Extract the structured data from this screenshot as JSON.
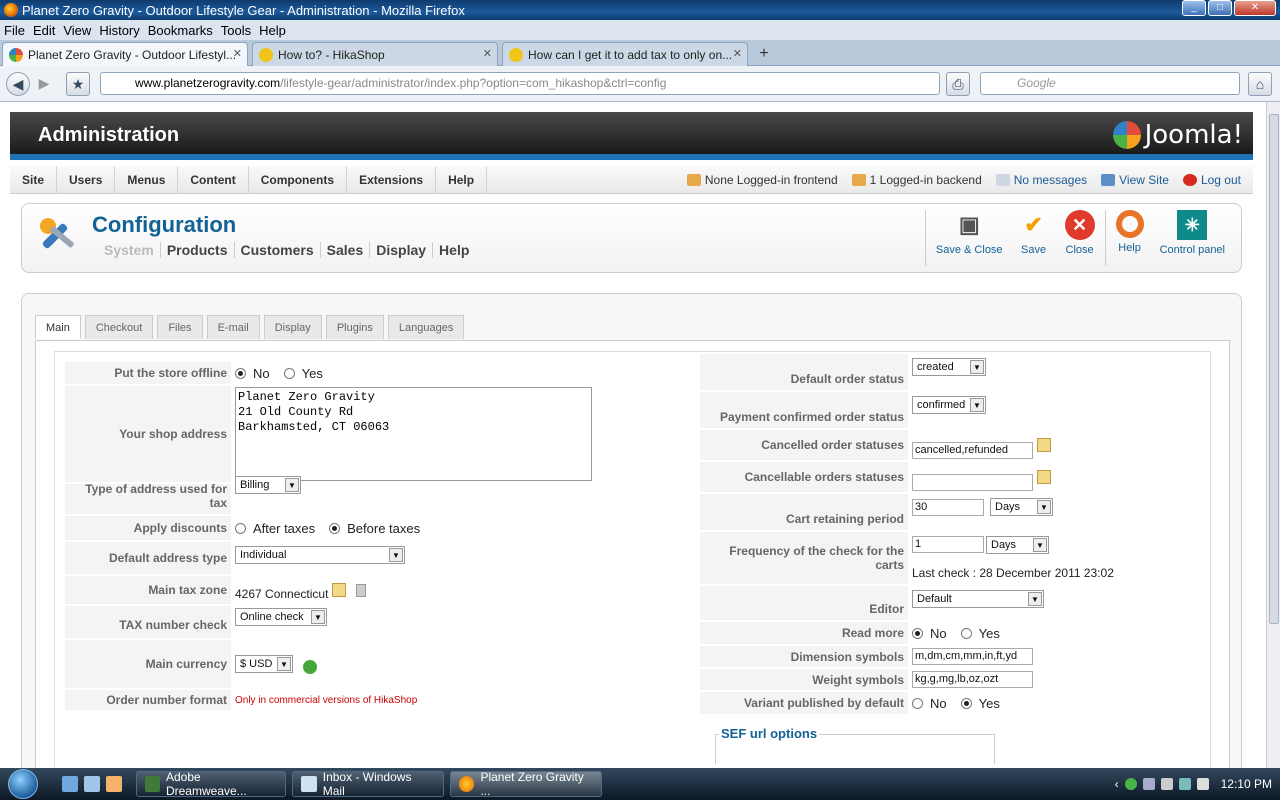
{
  "window": {
    "title": "Planet Zero Gravity - Outdoor Lifestyle Gear - Administration - Mozilla Firefox"
  },
  "menu": [
    "File",
    "Edit",
    "View",
    "History",
    "Bookmarks",
    "Tools",
    "Help"
  ],
  "tabs": [
    {
      "label": "Planet Zero Gravity - Outdoor Lifestyl...",
      "active": true
    },
    {
      "label": "How to? - HikaShop",
      "active": false
    },
    {
      "label": "How can I get it to add tax to only on...",
      "active": false
    }
  ],
  "url": {
    "domain": "www.planetzerogravity.com",
    "path": "/lifestyle-gear/administrator/index.php?option=com_hikashop&ctrl=config"
  },
  "search": {
    "placeholder": "Google"
  },
  "admin": {
    "title": "Administration",
    "brand": "Joomla!",
    "nav": [
      "Site",
      "Users",
      "Menus",
      "Content",
      "Components",
      "Extensions",
      "Help"
    ],
    "status": {
      "frontend": "None Logged-in frontend",
      "backend": "1 Logged-in backend",
      "messages": "No messages",
      "view_site": "View Site",
      "logout": "Log out"
    }
  },
  "config": {
    "title": "Configuration",
    "subnav": [
      "System",
      "Products",
      "Customers",
      "Sales",
      "Display",
      "Help"
    ],
    "buttons": {
      "save_close": "Save & Close",
      "save": "Save",
      "close": "Close",
      "help": "Help",
      "control_panel": "Control panel"
    },
    "tabs": [
      "Main",
      "Checkout",
      "Files",
      "E-mail",
      "Display",
      "Plugins",
      "Languages"
    ]
  },
  "left": {
    "offline_label": "Put the store offline",
    "no": "No",
    "yes": "Yes",
    "address_label": "Your shop address",
    "address": "Planet Zero Gravity\n21 Old County Rd\nBarkhamsted, CT 06063",
    "addr_type_label": "Type of address used for tax",
    "addr_type": "Billing",
    "discounts_label": "Apply discounts",
    "after_taxes": "After taxes",
    "before_taxes": "Before taxes",
    "default_addr_label": "Default address type",
    "default_addr": "Individual",
    "tax_zone_label": "Main tax zone",
    "tax_zone": "4267 Connecticut",
    "tax_check_label": "TAX number check",
    "tax_check": "Online check",
    "currency_label": "Main currency",
    "currency": "$ USD",
    "order_format_label": "Order number format",
    "order_format": "Only in commercial versions of HikaShop"
  },
  "right": {
    "default_status_label": "Default order status",
    "default_status": "created",
    "payment_status_label": "Payment confirmed order status",
    "payment_status": "confirmed",
    "cancelled_label": "Cancelled order statuses",
    "cancelled": "cancelled,refunded",
    "cancellable_label": "Cancellable orders statuses",
    "cancellable": "",
    "cart_label": "Cart retaining period",
    "cart_value": "30",
    "days": "Days",
    "freq_label": "Frequency of the check for the carts",
    "freq_value": "1",
    "last_check": "Last check : 28 December 2011 23:02",
    "editor_label": "Editor",
    "editor": "Default",
    "readmore_label": "Read more",
    "dim_label": "Dimension symbols",
    "dim": "m,dm,cm,mm,in,ft,yd",
    "weight_label": "Weight symbols",
    "weight": "kg,g,mg,lb,oz,ozt",
    "variant_label": "Variant published by default",
    "sef": "SEF url options"
  },
  "taskbar": {
    "items": [
      "Adobe Dreamweave...",
      "Inbox - Windows Mail",
      "Planet Zero Gravity ..."
    ],
    "clock": "12:10 PM"
  }
}
